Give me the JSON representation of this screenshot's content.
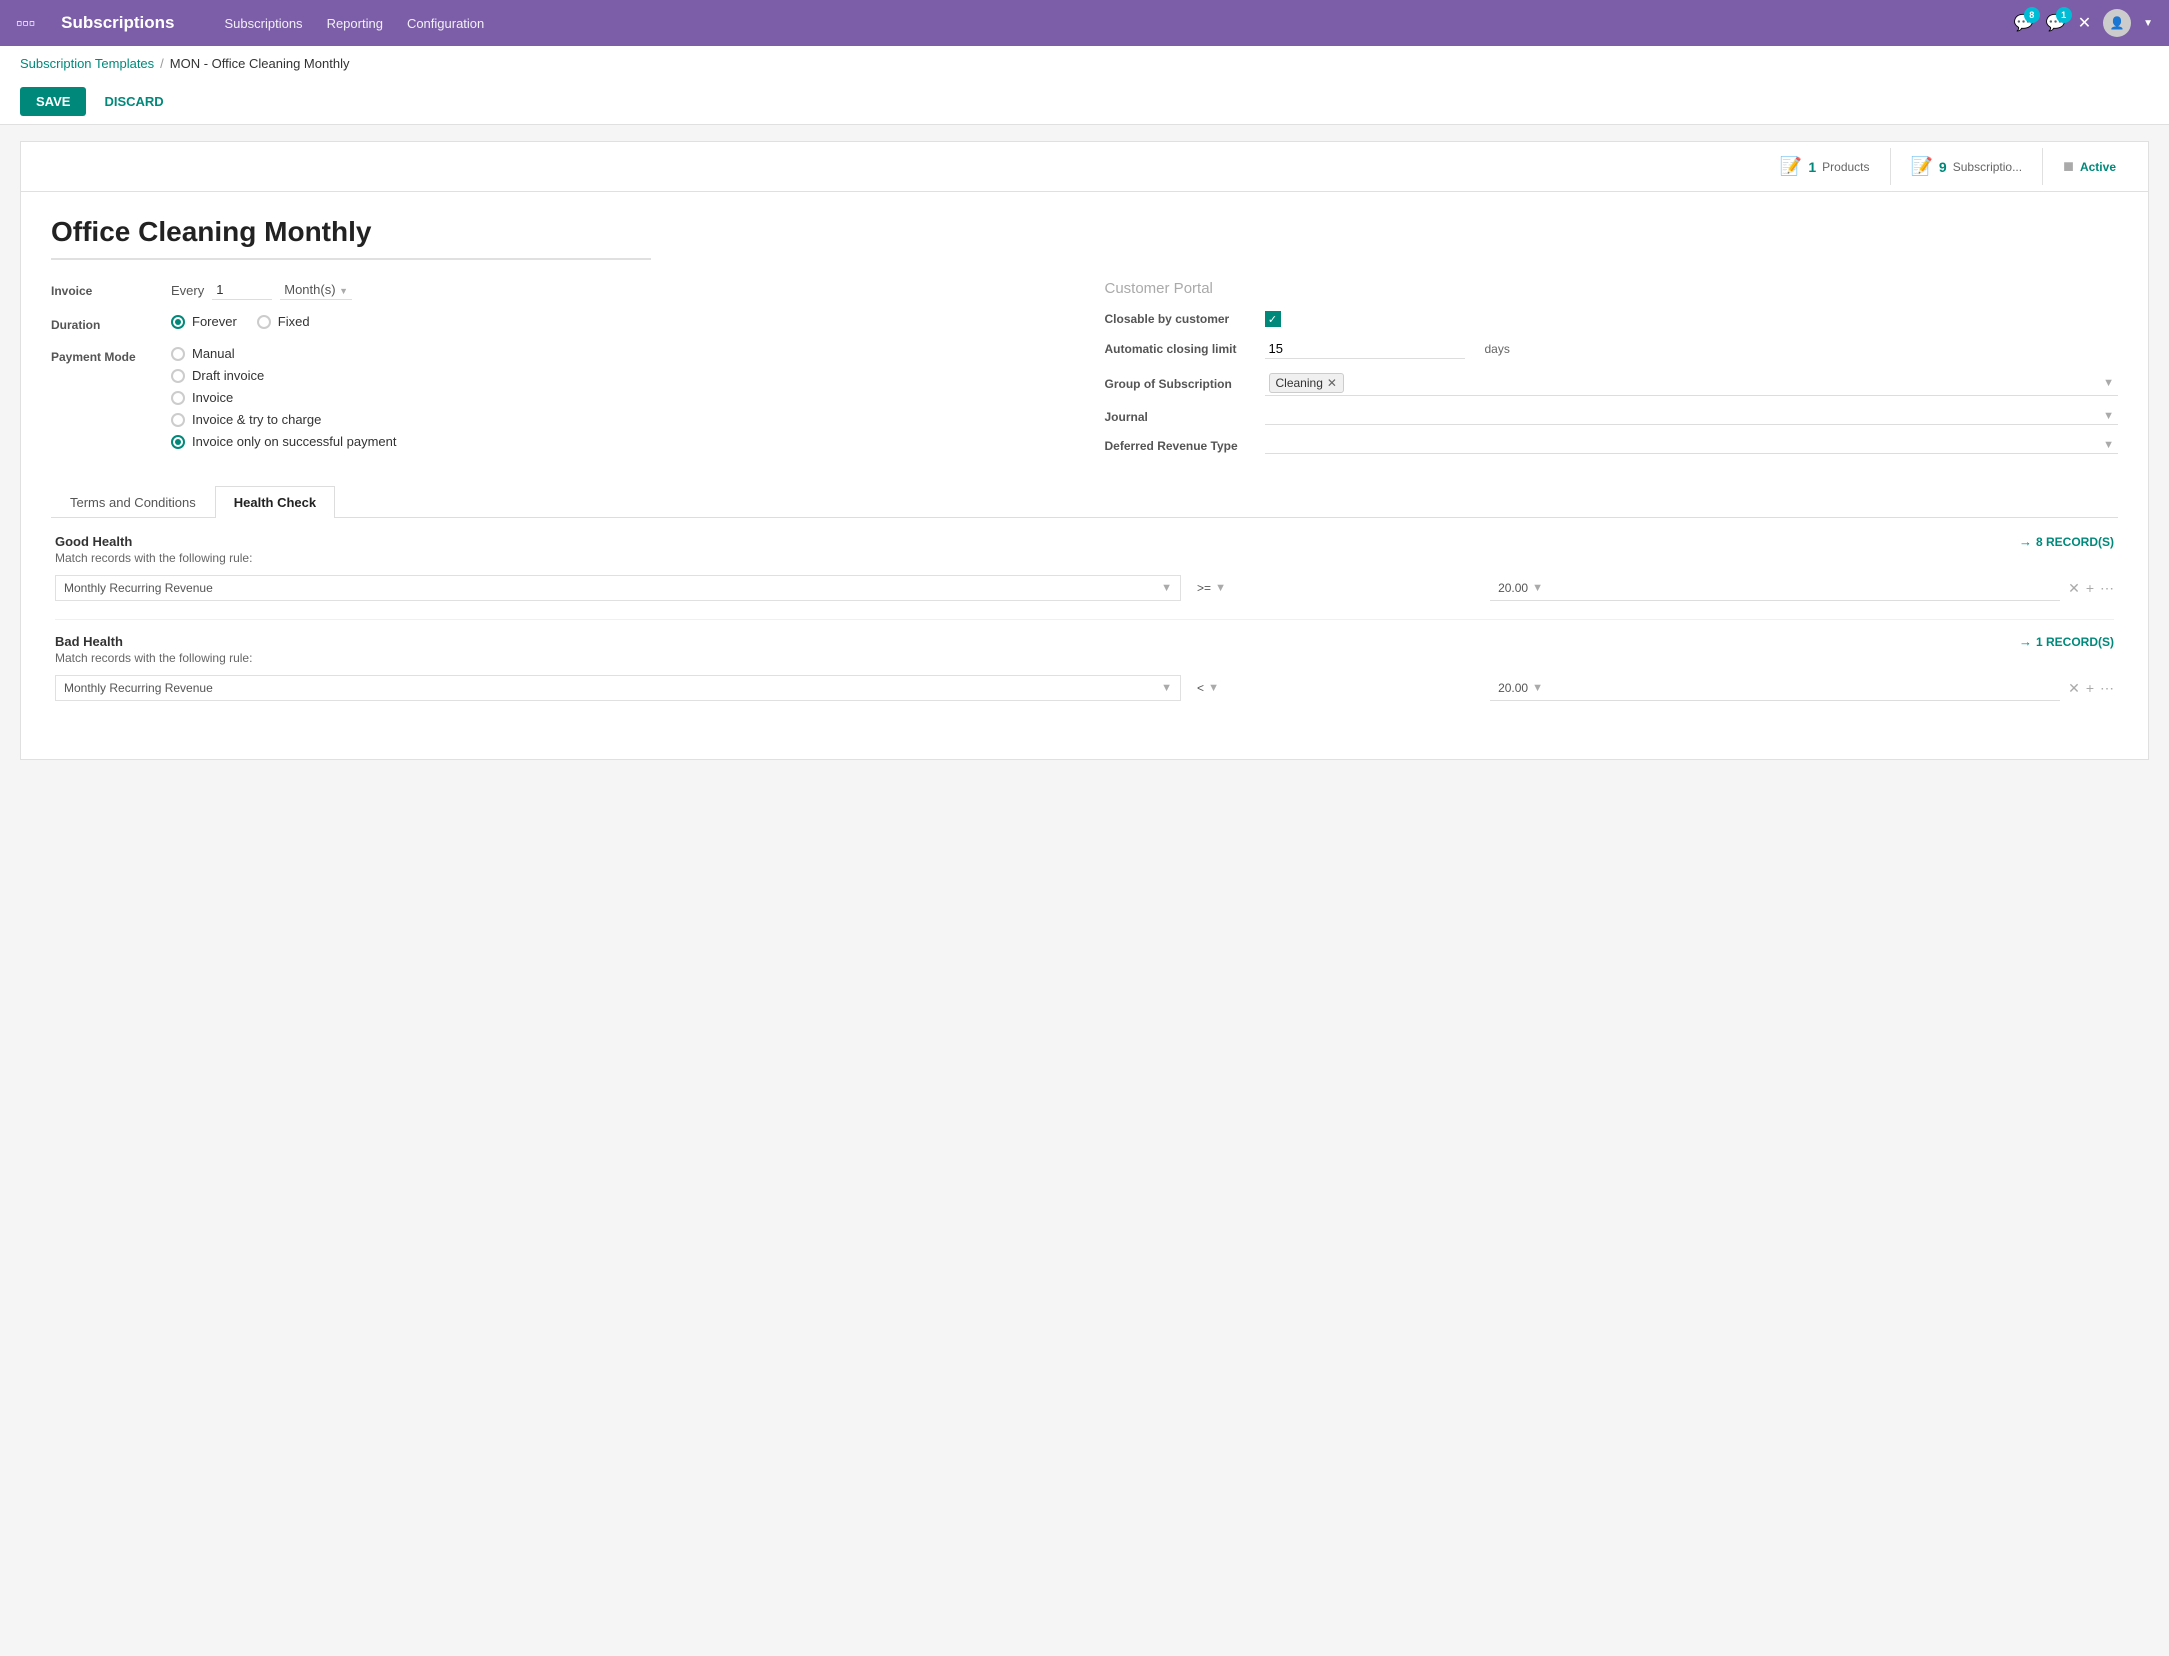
{
  "topnav": {
    "app_title": "Subscriptions",
    "nav_items": [
      "Subscriptions",
      "Reporting",
      "Configuration"
    ],
    "badge1_count": "8",
    "badge2_count": "1"
  },
  "breadcrumb": {
    "parent": "Subscription Templates",
    "separator": "/",
    "current": "MON - Office Cleaning Monthly"
  },
  "actions": {
    "save_label": "SAVE",
    "discard_label": "DISCARD"
  },
  "stats": {
    "products_count": "1",
    "products_label": "Products",
    "subscriptions_count": "9",
    "subscriptions_label": "Subscriptio...",
    "active_label": "Active"
  },
  "form": {
    "title": "Office Cleaning Monthly",
    "invoice_label": "Invoice",
    "invoice_every": "Every",
    "invoice_num": "1",
    "invoice_unit": "Month(s)",
    "duration_label": "Duration",
    "duration_forever": "Forever",
    "duration_fixed": "Fixed",
    "payment_label": "Payment Mode",
    "payment_options": [
      "Manual",
      "Draft invoice",
      "Invoice",
      "Invoice & try to charge",
      "Invoice only on successful payment"
    ],
    "payment_selected_index": 4
  },
  "customer_portal": {
    "title": "Customer Portal",
    "closable_label": "Closable by customer",
    "closing_limit_label": "Automatic closing limit",
    "closing_limit_value": "15",
    "closing_limit_unit": "days",
    "group_label": "Group of Subscription",
    "group_tag": "Cleaning",
    "journal_label": "Journal",
    "deferred_label": "Deferred Revenue Type"
  },
  "tabs": {
    "tab1": "Terms and Conditions",
    "tab2": "Health Check"
  },
  "health_check": {
    "good_label": "Good Health",
    "good_sub": "Match records with the following rule:",
    "good_records": "8 RECORD(S)",
    "good_field": "Monthly Recurring Revenue",
    "good_op": ">=",
    "good_val": "20.00",
    "bad_label": "Bad Health",
    "bad_sub": "Match records with the following rule:",
    "bad_records": "1 RECORD(S)",
    "bad_field": "Monthly Recurring Revenue",
    "bad_op": "<",
    "bad_val": "20.00"
  }
}
